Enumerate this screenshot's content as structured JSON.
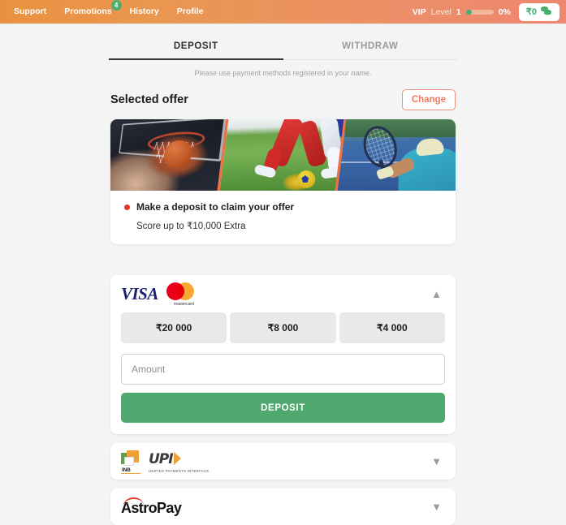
{
  "header": {
    "nav": [
      {
        "label": "Support",
        "badge": null
      },
      {
        "label": "Promotions",
        "badge": "4"
      },
      {
        "label": "History",
        "badge": null
      },
      {
        "label": "Profile",
        "badge": null
      }
    ],
    "vip": {
      "prefix": "VIP",
      "level_label": "Level",
      "level_value": "1",
      "progress_percent": "0%"
    },
    "balance": {
      "amount": "₹0",
      "icon": "coins-stack-icon"
    },
    "accent_color": "#ee8670",
    "gradient_start": "#e9913f",
    "gradient_end": "#ee8670"
  },
  "tabs": {
    "items": [
      {
        "label": "DEPOSIT",
        "active": true
      },
      {
        "label": "WITHDRAW",
        "active": false
      }
    ],
    "notice": "Please use payment methods registered in your name."
  },
  "offer_section": {
    "title": "Selected offer",
    "change_label": "Change",
    "banner": {
      "panels": [
        "basketball",
        "football",
        "tennis"
      ],
      "divider_color": "#ef7043"
    },
    "offer_title": "Make a deposit to claim your offer",
    "offer_subtitle": "Score up to ₹10,000 Extra",
    "status_dot_color": "#e8352c"
  },
  "payment_methods": [
    {
      "id": "card",
      "logos": [
        "visa",
        "mastercard"
      ],
      "mastercard_caption": "mastercard",
      "visa_label": "VISA",
      "expanded": true,
      "chevron": "chevron-up-icon",
      "quick_amounts": [
        "₹20 000",
        "₹8 000",
        "₹4 000"
      ],
      "amount_placeholder": "Amount",
      "amount_value": "",
      "submit_label": "DEPOSIT",
      "submit_color": "#4fa96e"
    },
    {
      "id": "upi",
      "logos": [
        "inb",
        "upi"
      ],
      "inb_label": "INB",
      "upi_label": "UPI",
      "upi_caption": "UNIFIED PAYMENTS INTERFACE",
      "expanded": false,
      "chevron": "chevron-down-icon"
    },
    {
      "id": "astropay",
      "logos": [
        "astropay"
      ],
      "astropay_label": "AstroPay",
      "expanded": false,
      "chevron": "chevron-down-icon"
    }
  ]
}
